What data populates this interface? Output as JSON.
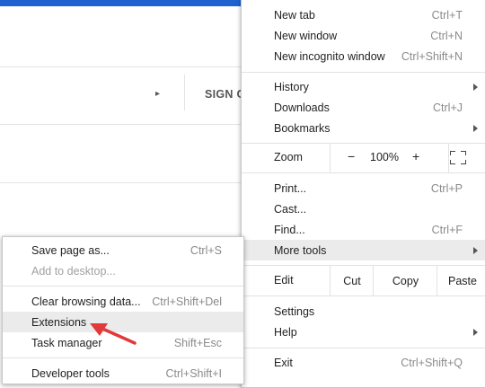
{
  "background": {
    "signin_label": "SIGN C",
    "accent_color": "#1f62cf"
  },
  "main_menu": {
    "new_tab": {
      "label": "New tab",
      "shortcut": "Ctrl+T"
    },
    "new_window": {
      "label": "New window",
      "shortcut": "Ctrl+N"
    },
    "new_incognito": {
      "label": "New incognito window",
      "shortcut": "Ctrl+Shift+N"
    },
    "history": {
      "label": "History"
    },
    "downloads": {
      "label": "Downloads",
      "shortcut": "Ctrl+J"
    },
    "bookmarks": {
      "label": "Bookmarks"
    },
    "zoom": {
      "label": "Zoom",
      "minus": "−",
      "value": "100%",
      "plus": "+"
    },
    "print": {
      "label": "Print...",
      "shortcut": "Ctrl+P"
    },
    "cast": {
      "label": "Cast..."
    },
    "find": {
      "label": "Find...",
      "shortcut": "Ctrl+F"
    },
    "more_tools": {
      "label": "More tools"
    },
    "edit": {
      "label": "Edit",
      "cut": "Cut",
      "copy": "Copy",
      "paste": "Paste"
    },
    "settings": {
      "label": "Settings"
    },
    "help": {
      "label": "Help"
    },
    "exit": {
      "label": "Exit",
      "shortcut": "Ctrl+Shift+Q"
    }
  },
  "sub_menu": {
    "save_page": {
      "label": "Save page as...",
      "shortcut": "Ctrl+S"
    },
    "add_to_desktop": {
      "label": "Add to desktop..."
    },
    "clear_browsing": {
      "label": "Clear browsing data...",
      "shortcut": "Ctrl+Shift+Del"
    },
    "extensions": {
      "label": "Extensions"
    },
    "task_manager": {
      "label": "Task manager",
      "shortcut": "Shift+Esc"
    },
    "developer_tools": {
      "label": "Developer tools",
      "shortcut": "Ctrl+Shift+I"
    }
  },
  "annotation": {
    "color": "#e03a3a",
    "icon": "red-arrow"
  }
}
